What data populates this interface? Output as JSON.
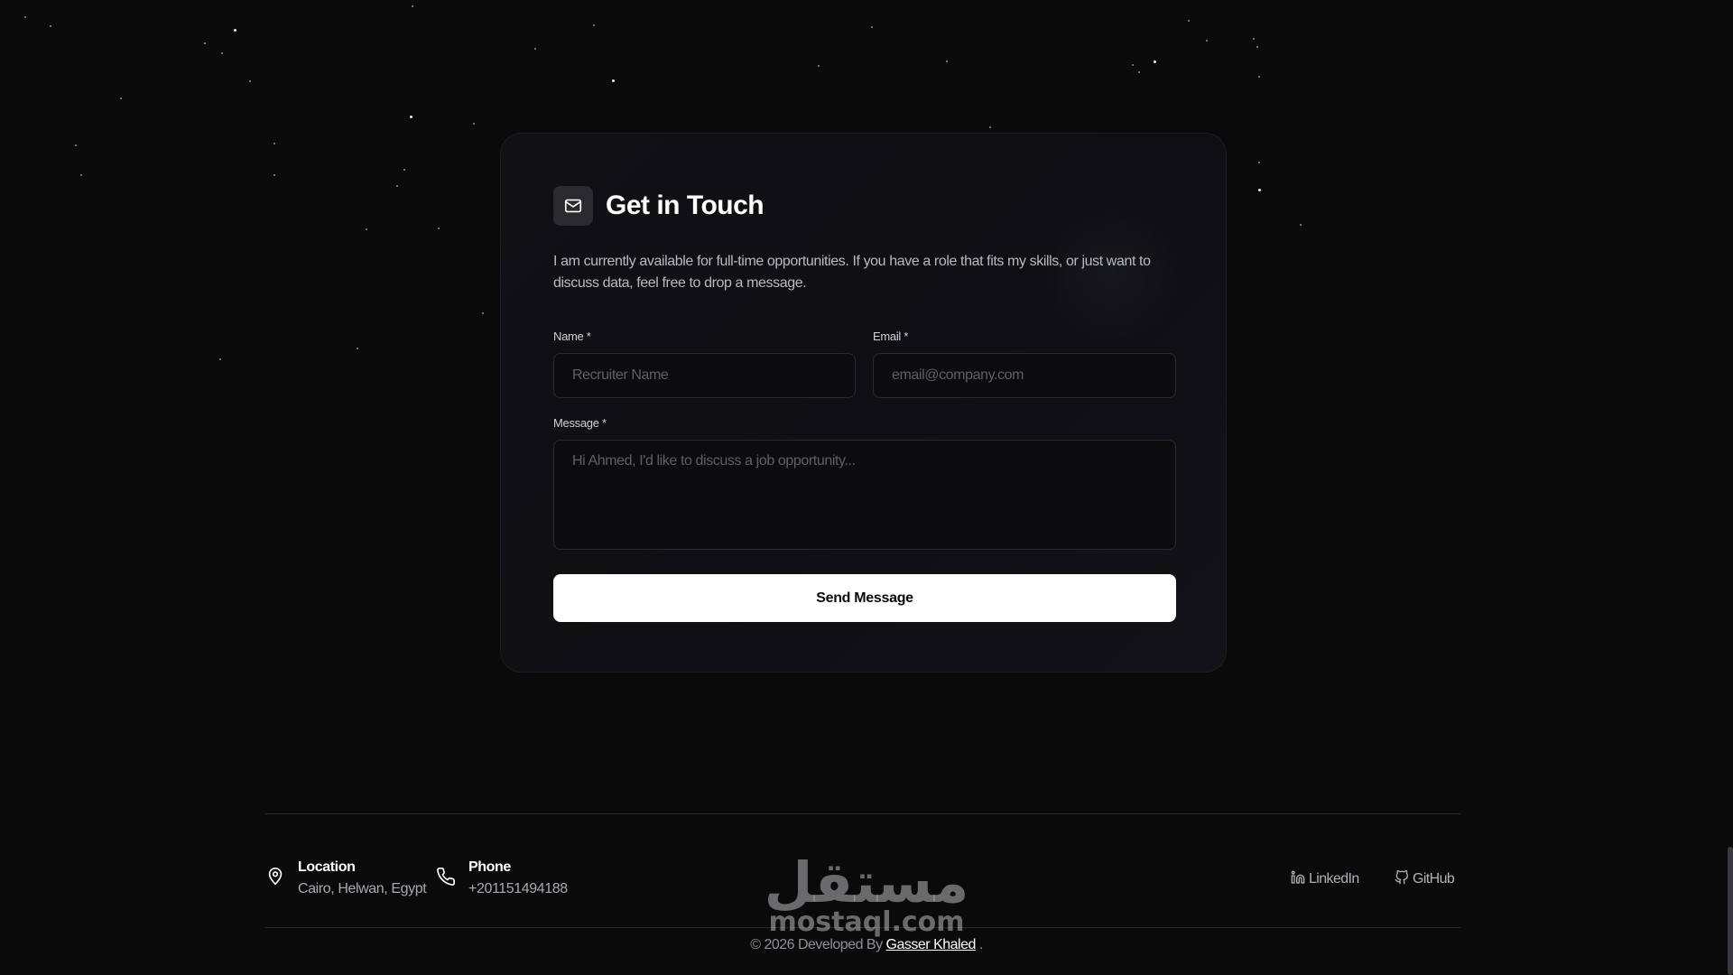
{
  "contact": {
    "title": "Get in Touch",
    "description": "I am currently available for full-time opportunities. If you have a role that fits my skills, or just want to discuss data, feel free to drop a message.",
    "name_label": "Name *",
    "name_placeholder": "Recruiter Name",
    "email_label": "Email *",
    "email_placeholder": "email@company.com",
    "message_label": "Message *",
    "message_placeholder": "Hi Ahmed, I'd like to discuss a job opportunity...",
    "send_label": "Send Message",
    "icon": "mail-icon"
  },
  "footer": {
    "location_title": "Location",
    "location_value": "Cairo, Helwan, Egypt",
    "phone_title": "Phone",
    "phone_value": "+201151494188",
    "linkedin_label": "LinkedIn",
    "github_label": "GitHub",
    "copyright_prefix": "© 2026 Developed By",
    "author": "Gasser Khaled",
    "copyright_suffix": "."
  },
  "watermark": {
    "arabic": "مستقل",
    "latin": "mostaql.com"
  }
}
